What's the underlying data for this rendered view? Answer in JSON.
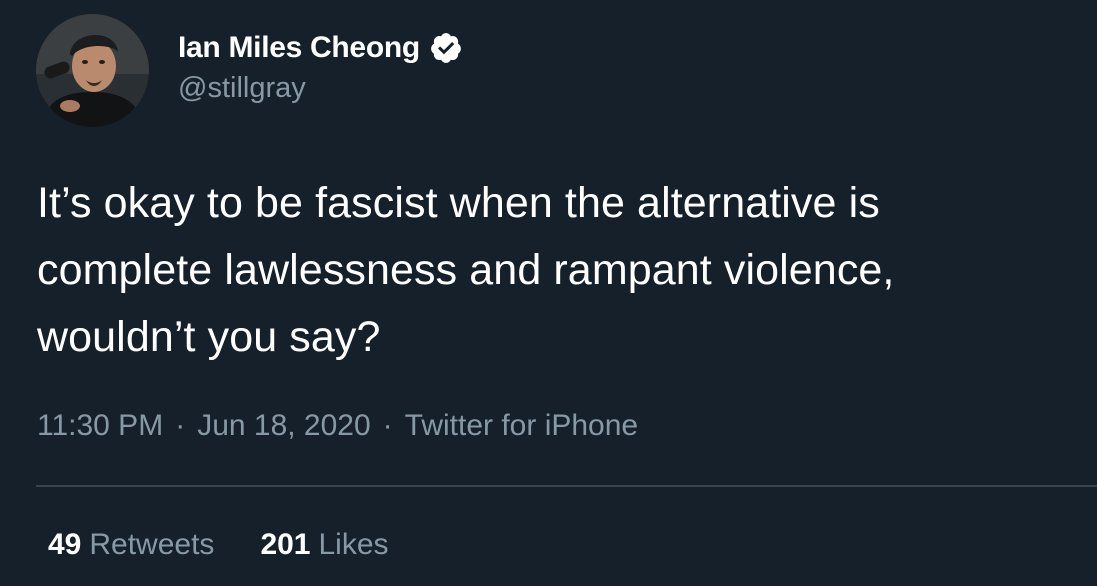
{
  "tweet": {
    "author": {
      "display_name": "Ian Miles Cheong",
      "handle": "@stillgray",
      "verified_icon": "verified-badge-icon",
      "avatar": "profile-photo"
    },
    "text": "It’s okay to be fascist when the alternative is\ncomplete lawlessness and rampant violence,\nwouldn’t you say?",
    "meta": {
      "time": "11:30 PM",
      "separator": "·",
      "date": "Jun 18, 2020",
      "source": "Twitter for iPhone"
    },
    "stats": {
      "retweets_count": "49",
      "retweets_label": "Retweets",
      "likes_count": "201",
      "likes_label": "Likes"
    }
  },
  "colors": {
    "background": "#15202b",
    "primary_text": "#ffffff",
    "secondary_text": "#8899a6",
    "divider": "#38444d"
  }
}
